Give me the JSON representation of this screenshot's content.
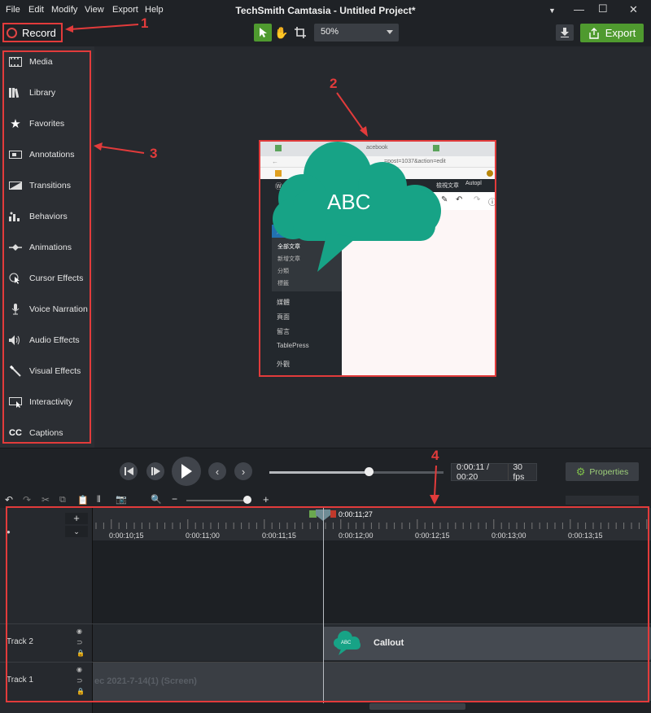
{
  "menubar": {
    "items": [
      "File",
      "Edit",
      "Modify",
      "View",
      "Export",
      "Help"
    ],
    "title": "TechSmith Camtasia - Untitled Project*"
  },
  "toolbar": {
    "record_label": "Record",
    "zoom_value": "50%",
    "export_label": "Export"
  },
  "sidebar": {
    "items": [
      {
        "label": "Media",
        "icon": "film-icon"
      },
      {
        "label": "Library",
        "icon": "library-icon"
      },
      {
        "label": "Favorites",
        "icon": "star-icon"
      },
      {
        "label": "Annotations",
        "icon": "annotation-icon"
      },
      {
        "label": "Transitions",
        "icon": "transition-icon"
      },
      {
        "label": "Behaviors",
        "icon": "behavior-icon"
      },
      {
        "label": "Animations",
        "icon": "animation-icon"
      },
      {
        "label": "Cursor Effects",
        "icon": "cursor-icon"
      },
      {
        "label": "Voice Narration",
        "icon": "microphone-icon"
      },
      {
        "label": "Audio Effects",
        "icon": "speaker-icon"
      },
      {
        "label": "Visual Effects",
        "icon": "wand-icon"
      },
      {
        "label": "Interactivity",
        "icon": "interactivity-icon"
      },
      {
        "label": "Captions",
        "icon": "cc-icon"
      }
    ]
  },
  "preview": {
    "callout_text": "ABC",
    "tab_text": "acebook",
    "url_text": "=post=1037&action=edit",
    "sidebar_items": [
      "全部文章",
      "新增文章",
      "分類",
      "標籤"
    ],
    "menu_items": [
      "媒體",
      "頁面",
      "留言",
      "TablePress",
      "外觀"
    ],
    "header_tab": "檢視文章",
    "autoplay_text": "Autopl"
  },
  "playback": {
    "time": "0:00:11 / 00:20",
    "fps": "30 fps",
    "properties_label": "Properties",
    "progress": 0.57
  },
  "timeline": {
    "playhead_time": "0:00:11;27",
    "ticks": [
      "0:00:10;15",
      "0:00:11;00",
      "0:00:11;15",
      "0:00:12;00",
      "0:00:12;15",
      "0:00:13;00",
      "0:00:13;15"
    ],
    "tracks": [
      {
        "name": "Track 2",
        "clip": "Callout",
        "clip_icon_text": "ABC"
      },
      {
        "name": "Track 1",
        "clip": "ec 2021-7-14(1) (Screen)"
      }
    ]
  },
  "annotations": [
    "1",
    "2",
    "3",
    "4"
  ],
  "colors": {
    "accent_green": "#4f9a2f",
    "callout_teal": "#17a386",
    "annotation_red": "#e23b3b",
    "record_red": "#e04545"
  }
}
